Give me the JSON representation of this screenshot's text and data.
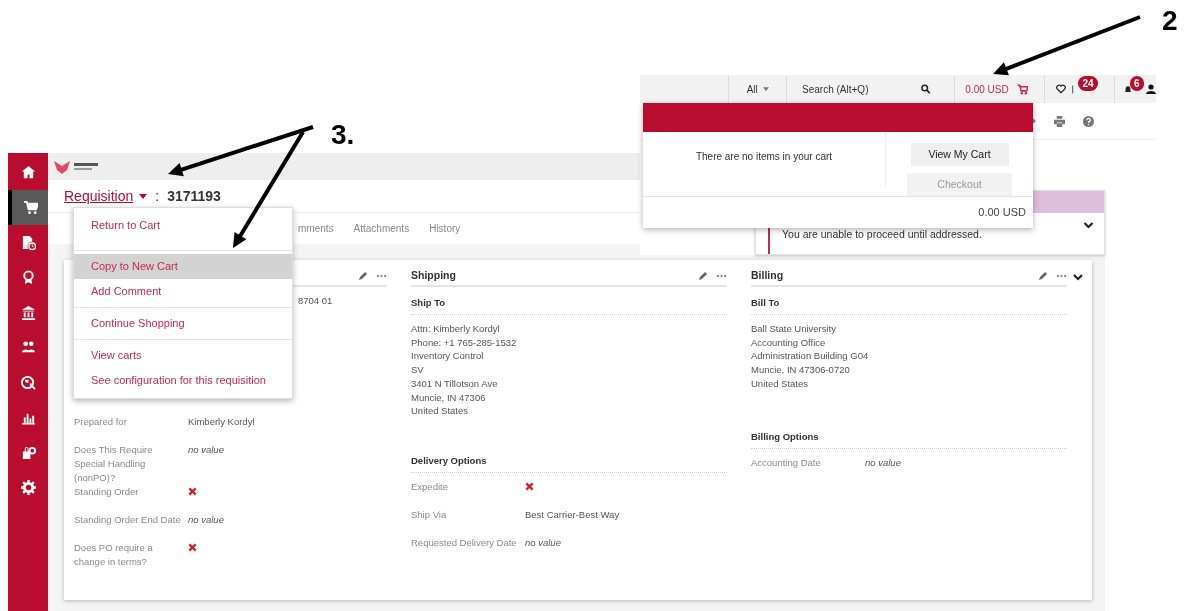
{
  "annotations": [
    {
      "label": "2"
    },
    {
      "label": "3."
    }
  ],
  "top_bar": {
    "scope": "All",
    "search_placeholder": "Search (Alt+Q)",
    "cart_total": "0.00 USD",
    "flag_count": "24",
    "notification_count": "6"
  },
  "cart_popup": {
    "message": "There are no items in your cart",
    "buttons": [
      {
        "label": "View My Cart",
        "disabled": false
      },
      {
        "label": "Checkout",
        "disabled": true
      }
    ],
    "total": "0.00 USD"
  },
  "alert": {
    "message": "You are unable to proceed until addressed."
  },
  "sidebar": {
    "items": [
      {
        "selected": false
      },
      {
        "selected": true
      },
      {
        "selected": false
      },
      {
        "selected": false
      },
      {
        "selected": false
      },
      {
        "selected": false
      },
      {
        "selected": false
      },
      {
        "selected": false
      },
      {
        "selected": false
      },
      {
        "selected": false
      }
    ]
  },
  "header": {
    "title_link": "Requisition",
    "separator": ":",
    "number": "3171193"
  },
  "tabs": [
    {
      "label": "mments",
      "selected": false
    },
    {
      "label": "Attachments",
      "selected": false
    },
    {
      "label": "History",
      "selected": false
    }
  ],
  "menu": {
    "groups": [
      [
        {
          "label": "Return to Cart",
          "selected": false
        }
      ],
      [
        {
          "label": "Copy to New Cart",
          "selected": true
        },
        {
          "label": "Add Comment",
          "selected": false
        }
      ],
      [
        {
          "label": "Continue Shopping",
          "selected": false
        }
      ],
      [
        {
          "label": "View carts",
          "selected": false
        },
        {
          "label": "See configuration for this requisition",
          "selected": false
        }
      ]
    ]
  },
  "general": {
    "partial_value": "8704 01",
    "fields": [
      {
        "label": "Prepared for",
        "kind": "text",
        "value": "Kimberly Kordyl"
      },
      {
        "label": "Does This Require Special Handling (nonPO)?",
        "kind": "empty",
        "value": "no value"
      },
      {
        "label": "Standing Order",
        "kind": "cross"
      },
      {
        "label": "Standing Order End Date",
        "kind": "empty",
        "value": "no value"
      },
      {
        "label": "Does PO require a change in terms?",
        "kind": "cross"
      }
    ]
  },
  "shipping": {
    "title": "Shipping",
    "ship_to": {
      "title": "Ship To",
      "lines": [
        "Attn: Kimberly Kordyl",
        "Phone: +1 765-285-1532",
        "Inventory Control",
        "SV",
        "3401 N Tillotson Ave",
        "Muncie, IN 47306",
        "United States"
      ]
    },
    "options": {
      "title": "Delivery Options",
      "fields": [
        {
          "label": "Expedite",
          "kind": "cross"
        },
        {
          "label": "Ship Via",
          "kind": "text",
          "value": "Best Carrier-Best Way"
        },
        {
          "label": "Requested Delivery Date",
          "kind": "empty",
          "value": "no value"
        }
      ]
    }
  },
  "billing": {
    "title": "Billing",
    "bill_to": {
      "title": "Bill To",
      "lines": [
        "Ball State University",
        "Accounting Office",
        "Administration Building G04",
        "Muncie, IN 47306-0720",
        "United States"
      ]
    },
    "options": {
      "title": "Billing Options",
      "fields": [
        {
          "label": "Accounting Date",
          "kind": "empty",
          "value": "no value"
        }
      ]
    }
  }
}
